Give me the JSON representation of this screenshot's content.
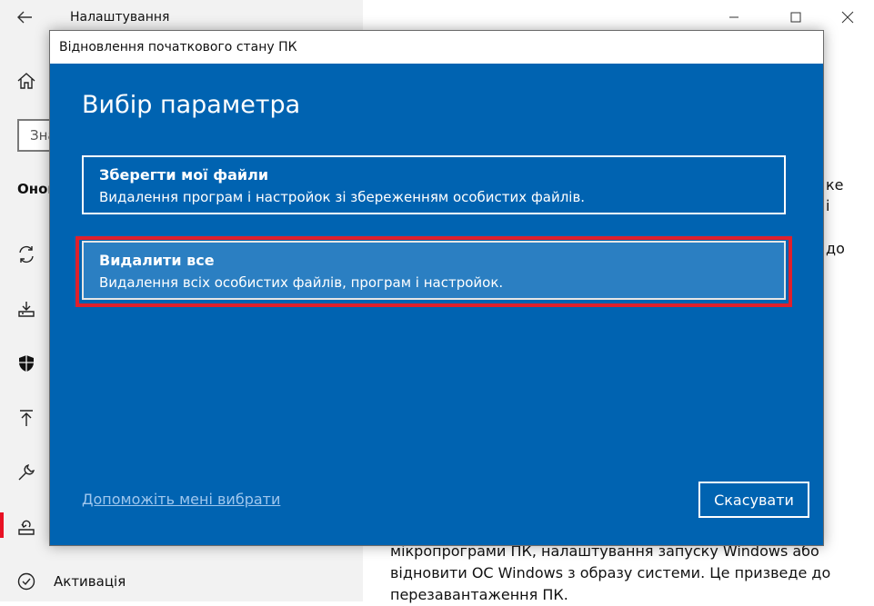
{
  "settings": {
    "title": "Налаштування",
    "search_placeholder": "Знайти параметр",
    "section_heading": "Оновлення та безпека",
    "nav": {
      "activation_label": "Активація"
    },
    "right_text": [
      "мікропрограми ПК, налаштування запуску Windows або",
      "відновити ОС Windows з образу системи. Це призведе до",
      "перезавантаження ПК."
    ],
    "right_fragments": [
      "ке",
      "і",
      "до"
    ]
  },
  "dialog": {
    "title": "Відновлення початкового стану ПК",
    "heading": "Вибір параметра",
    "options": [
      {
        "title": "Зберегти мої файли",
        "description": "Видалення програм і настройок зі збереженням особистих файлів."
      },
      {
        "title": "Видалити все",
        "description": "Видалення всіх особистих файлів, програм і настройок."
      }
    ],
    "help_link": "Допоможіть мені вибрати",
    "cancel_label": "Скасувати"
  },
  "colors": {
    "dialog_bg": "#0063b1",
    "selected_option_bg": "#2b7fc2",
    "highlight": "#e0202c",
    "accent_bar": "#e81123"
  }
}
